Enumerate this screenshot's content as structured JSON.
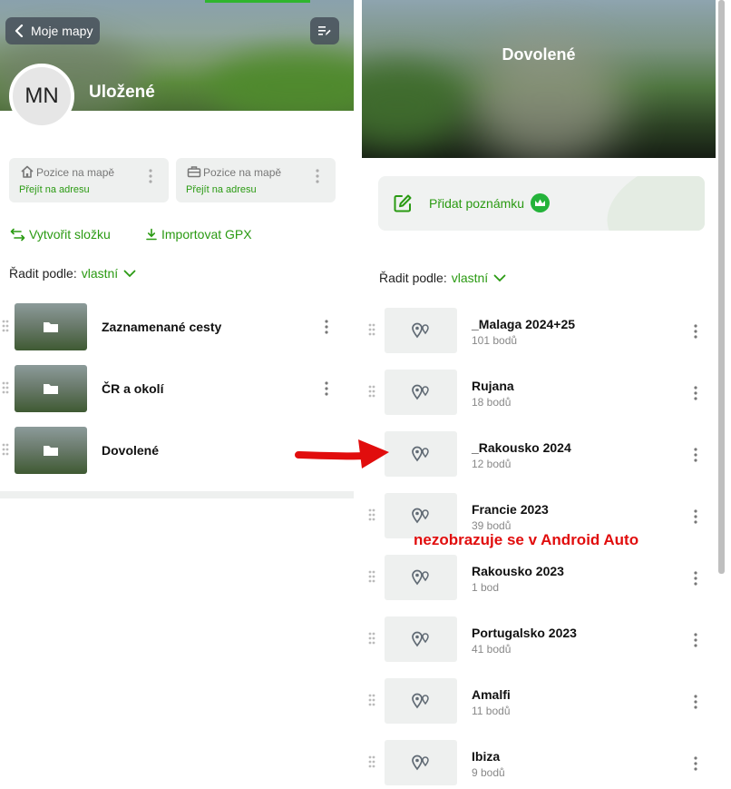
{
  "left": {
    "back_label": "Moje mapy",
    "avatar_initials": "MN",
    "title": "Uložené",
    "position_cards": [
      {
        "title": "Pozice na mapě",
        "link": "Přejít na adresu",
        "icon": "home-icon"
      },
      {
        "title": "Pozice na mapě",
        "link": "Přejít na adresu",
        "icon": "briefcase-icon"
      }
    ],
    "actions": {
      "create_folder": "Vytvořit složku",
      "import_gpx": "Importovat GPX"
    },
    "sort": {
      "label": "Řadit podle:",
      "value": "vlastní"
    },
    "folders": [
      {
        "name": "Zaznamenané cesty"
      },
      {
        "name": "ČR a okolí"
      },
      {
        "name": "Dovolené"
      }
    ]
  },
  "right": {
    "title": "Dovolené",
    "add_note_label": "Přidat poznámku",
    "sort": {
      "label": "Řadit podle:",
      "value": "vlastní"
    },
    "items": [
      {
        "name": "_Malaga 2024+25",
        "count": "101 bodů"
      },
      {
        "name": "Rujana",
        "count": "18 bodů"
      },
      {
        "name": "_Rakousko 2024",
        "count": "12 bodů"
      },
      {
        "name": "Francie 2023",
        "count": "39 bodů"
      },
      {
        "name": "Rakousko 2023",
        "count": "1 bod"
      },
      {
        "name": "Portugalsko 2023",
        "count": "41 bodů"
      },
      {
        "name": "Amalfi",
        "count": "11 bodů"
      },
      {
        "name": "Ibiza",
        "count": "9 bodů"
      }
    ]
  },
  "annotation": {
    "text": "nezobrazuje se v Android Auto"
  },
  "colors": {
    "accent_green": "#2a9a12",
    "annotation_red": "#e10d0d"
  }
}
